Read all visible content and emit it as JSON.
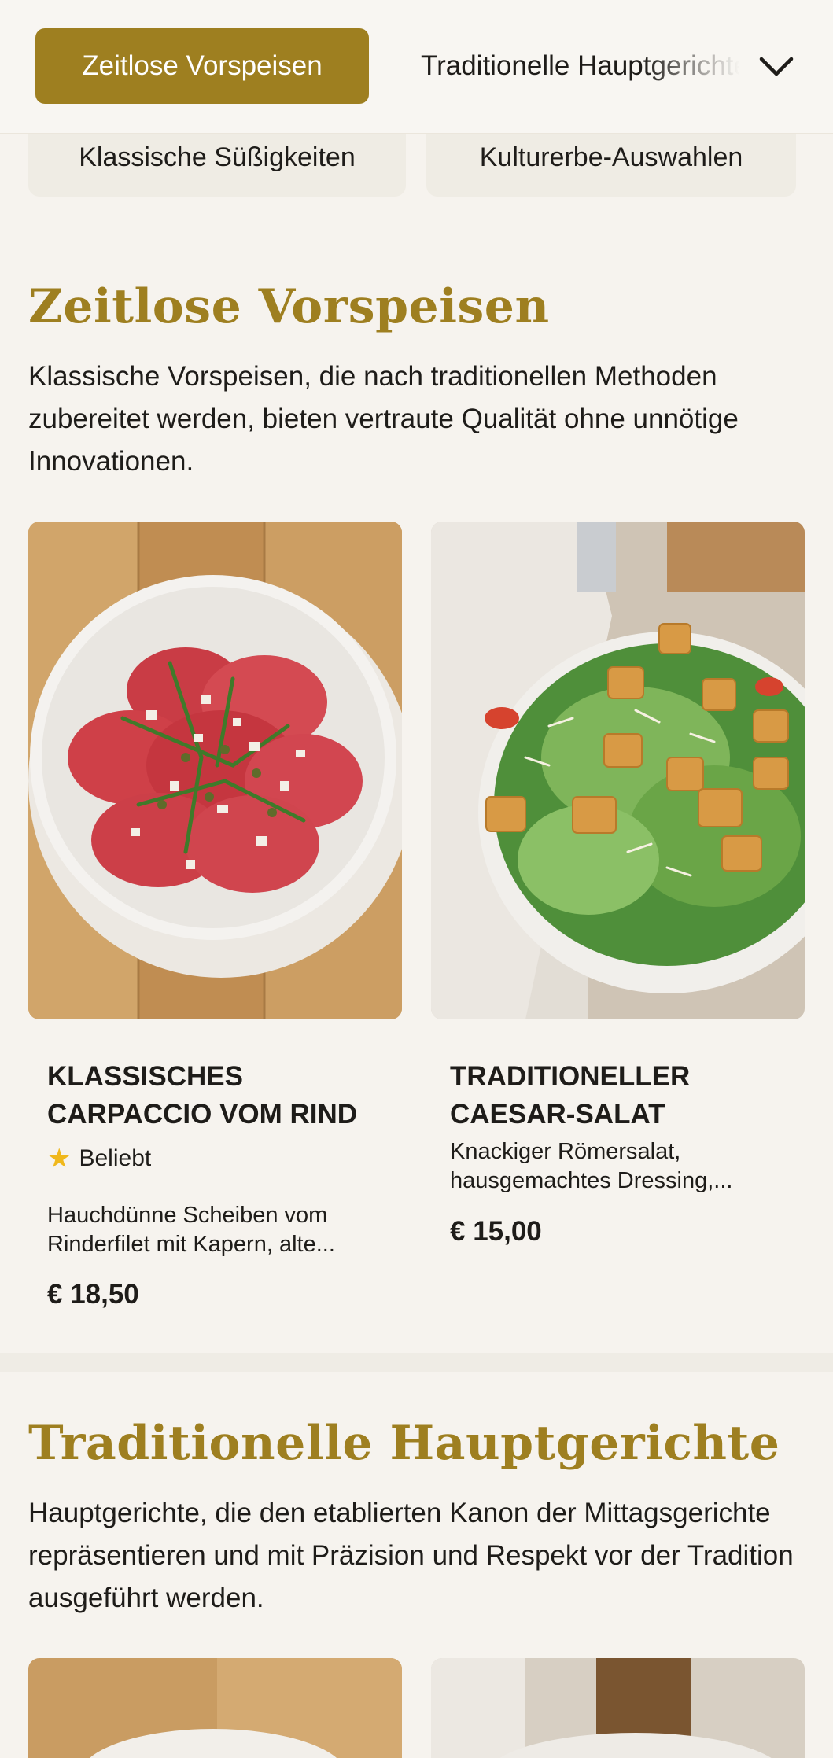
{
  "nav": {
    "active_category": "Zeitlose Vorspeisen",
    "next_category": "Traditionelle Hauptgerichte",
    "chips": [
      "Klassische Süßigkeiten",
      "Kulturerbe-Auswahlen"
    ],
    "expand_icon": "chevron-down-icon",
    "accent_color": "#9e7f20"
  },
  "sections": [
    {
      "title": "Zeitlose Vorspeisen",
      "description": "Klassische Vorspeisen, die nach traditionellen Methoden zubereitet werden, bieten vertraute Qualität ohne unnötige Innovationen.",
      "dishes": [
        {
          "name": "Klassisches Carpaccio vom Rind",
          "badge": "Beliebt",
          "badge_icon": "star-icon",
          "description": "Hauchdünne Scheiben vom Rinderfilet mit Kapern, alte...",
          "price": "€ 18,50"
        },
        {
          "name": "Traditioneller Caesar-Salat",
          "description": "Knackiger Römersalat, hausgemachtes Dressing,...",
          "price": "€ 15,00"
        }
      ]
    },
    {
      "title": "Traditionelle Hauptgerichte",
      "description": "Hauptgerichte, die den etablierten Kanon der Mittagsgerichte repräsentieren und mit Präzision und Respekt vor der Tradition ausgeführt werden."
    }
  ]
}
